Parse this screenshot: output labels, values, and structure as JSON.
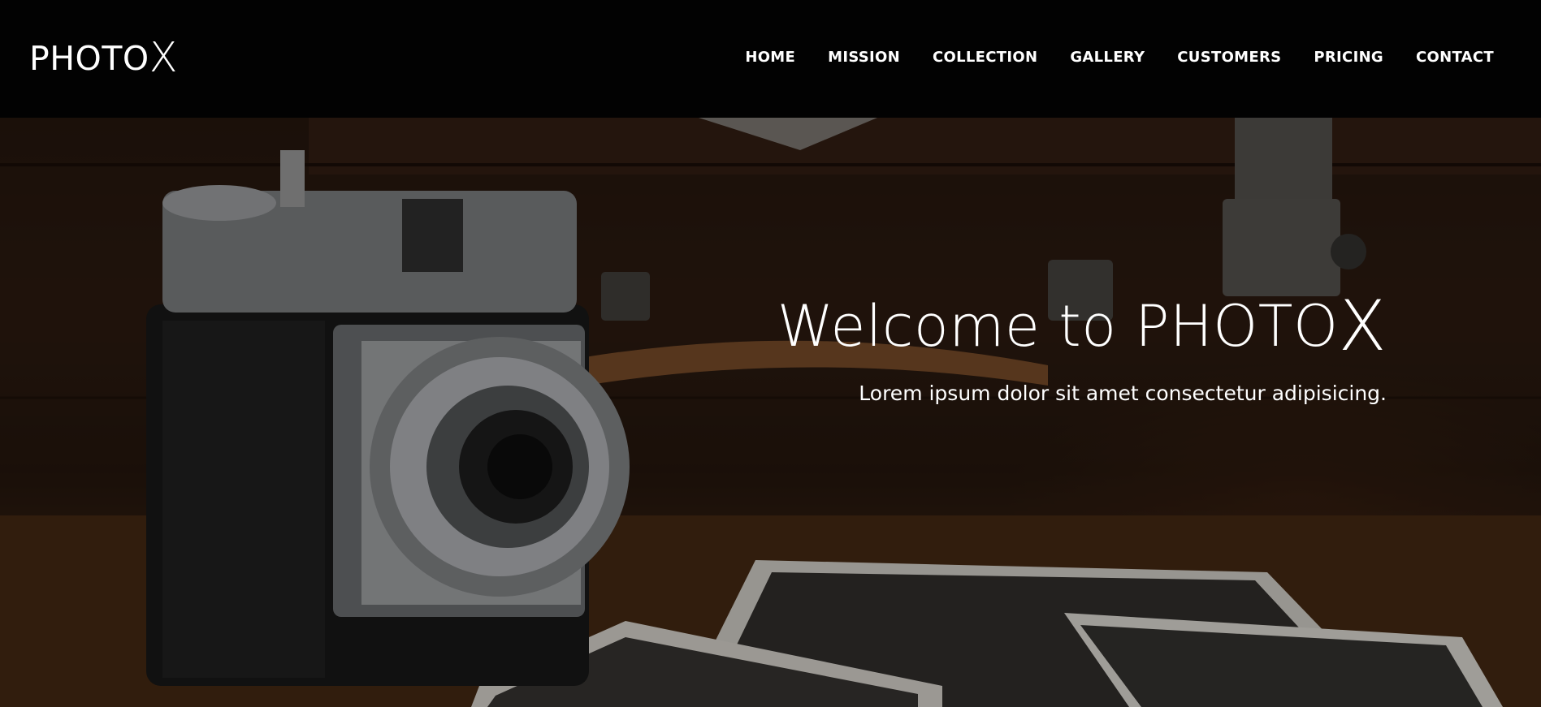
{
  "header": {
    "logo_main": "PHOTO",
    "logo_accent": "X",
    "nav": [
      {
        "label": "HOME"
      },
      {
        "label": "MISSION"
      },
      {
        "label": "COLLECTION"
      },
      {
        "label": "GALLERY"
      },
      {
        "label": "CUSTOMERS"
      },
      {
        "label": "PRICING"
      },
      {
        "label": "CONTACT"
      }
    ]
  },
  "hero": {
    "title_prefix": "Welcome to PHOTO",
    "title_accent": "X",
    "subtitle": "Lorem ipsum dolor sit amet consectetur adipisicing.",
    "background_image": "vintage-camera-and-photographs"
  },
  "colors": {
    "header_background": "#020202",
    "text": "#ffffff"
  }
}
